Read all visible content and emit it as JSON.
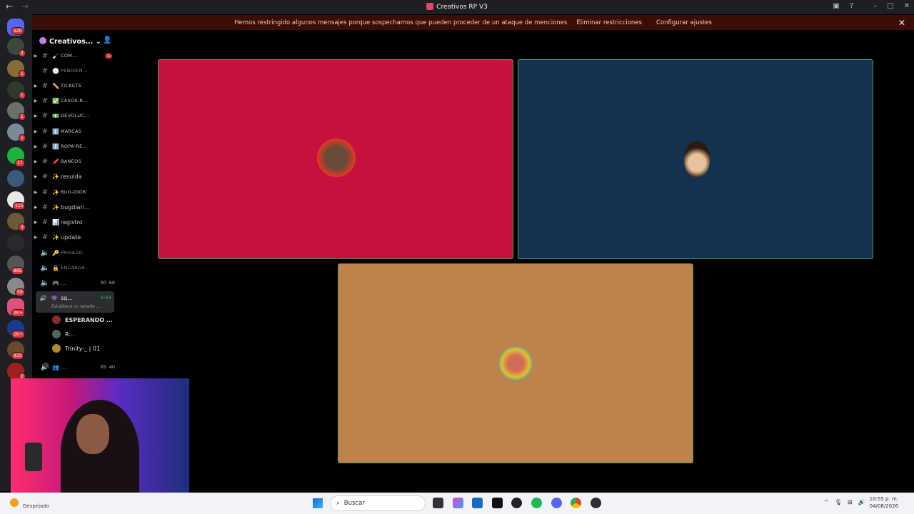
{
  "window": {
    "title": "Creativos RP V3"
  },
  "notice": {
    "message": "Hemos restringido algunos mensajes porque sospechamos que pueden proceder de un ataque de menciones",
    "action1": "Eliminar restricciones",
    "action2": "Configurar ajustes"
  },
  "servers": {
    "badges": [
      "520",
      "2",
      "1",
      "1",
      "1",
      "1",
      "27",
      "115",
      "3",
      "865",
      "59",
      "2K+",
      "1K+",
      "933",
      "2"
    ]
  },
  "guild": {
    "name": "Creativos..."
  },
  "channels": [
    {
      "name": "COM...",
      "emoji": "🧹",
      "count": "1",
      "style": "small"
    },
    {
      "name": "PENDIEN...",
      "emoji": "🕒",
      "style": "small muted"
    },
    {
      "name": "TICKETS",
      "emoji": "✏️",
      "style": "small"
    },
    {
      "name": "CASOS-R...",
      "emoji": "✅",
      "style": "small"
    },
    {
      "name": "DEVOLUC...",
      "emoji": "💵",
      "style": "small"
    },
    {
      "name": "MARCAS",
      "emoji": "ℹ️",
      "style": "small"
    },
    {
      "name": "ROPA-RE...",
      "emoji": "ℹ️",
      "style": "small"
    },
    {
      "name": "BANEOS",
      "emoji": "🖍️",
      "style": "small"
    },
    {
      "name": "resulda",
      "emoji": "✨",
      "style": ""
    },
    {
      "name": "BUG-DIOR",
      "emoji": "✨",
      "style": "small"
    },
    {
      "name": "bugdiari...",
      "emoji": "✨",
      "style": ""
    },
    {
      "name": "registro",
      "emoji": "📊",
      "style": ""
    },
    {
      "name": "update",
      "emoji": "✨",
      "style": ""
    }
  ],
  "voice_channels": [
    {
      "name": "PRIVADO",
      "emoji": "🔑"
    },
    {
      "name": "ENCARGA...",
      "emoji": "🔒"
    },
    {
      "name": "...",
      "emoji": "🎮",
      "pill1": "00",
      "pill2": "60"
    }
  ],
  "active_voice": {
    "name": "sq...",
    "timer": "5:43",
    "status": "Establece un estado ..."
  },
  "members": [
    "ESPERANDO ...",
    "R...",
    "Trinity-_ | 01"
  ],
  "voice_channel2": {
    "name": "...",
    "pill1": "05",
    "pill2": "40"
  },
  "taskbar": {
    "search_placeholder": "Buscar",
    "time": "10:55 p. m.",
    "date": "04/08/2026",
    "weather": "Despejado"
  },
  "colors": {
    "tile1": "#c8103f",
    "tile2": "#14324f",
    "tile3": "#bf824a",
    "speaking_border": "#3ba55c"
  }
}
